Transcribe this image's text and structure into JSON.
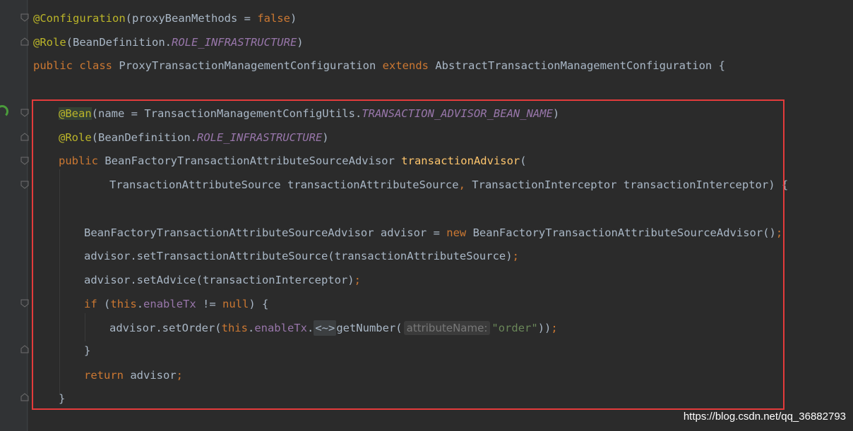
{
  "code": {
    "l1": {
      "ann": "@Configuration",
      "open": "(",
      "param": "proxyBeanMethods = ",
      "val": "false",
      "close": ")"
    },
    "l2": {
      "ann": "@Role",
      "open": "(BeanDefinition.",
      "const": "ROLE_INFRASTRUCTURE",
      "close": ")"
    },
    "l3": {
      "kw1": "public",
      "kw2": "class",
      "name": "ProxyTransactionManagementConfiguration",
      "kw3": "extends",
      "parent": "AbstractTransactionManagementConfiguration {"
    },
    "l5": {
      "ann": "@Bean",
      "open": "(name = TransactionManagementConfigUtils.",
      "const": "TRANSACTION_ADVISOR_BEAN_NAME",
      "close": ")"
    },
    "l6": {
      "ann": "@Role",
      "open": "(BeanDefinition.",
      "const": "ROLE_INFRASTRUCTURE",
      "close": ")"
    },
    "l7": {
      "kw": "public",
      "type": "BeanFactoryTransactionAttributeSourceAdvisor",
      "method": "transactionAdvisor",
      "open": "("
    },
    "l8": {
      "p1": "TransactionAttributeSource transactionAttributeSource",
      "comma": ",",
      "p2": "TransactionInterceptor transactionInterceptor) {"
    },
    "l10": {
      "decl": "BeanFactoryTransactionAttributeSourceAdvisor advisor = ",
      "kw": "new",
      "ctor": "BeanFactoryTransactionAttributeSourceAdvisor()",
      "semi": ";"
    },
    "l11": {
      "text": "advisor.setTransactionAttributeSource(transactionAttributeSource)",
      "semi": ";"
    },
    "l12": {
      "text": "advisor.setAdvice(transactionInterceptor)",
      "semi": ";"
    },
    "l13": {
      "kw": "if",
      "open": "(",
      "this": "this",
      "dot": ".",
      "field": "enableTx",
      "op": " != ",
      "null": "null",
      "close": ") {"
    },
    "l14": {
      "pre": "advisor.setOrder(",
      "this": "this",
      "dot": ".",
      "field": "enableTx",
      "dot2": ".",
      "fold": "<~>",
      "call": "getNumber(",
      "hint": "attributeName:",
      "str": "\"order\"",
      "close": "))",
      "semi": ";"
    },
    "l15": {
      "text": "}"
    },
    "l16": {
      "kw": "return",
      "text": " advisor",
      "semi": ";"
    },
    "l17": {
      "text": "}"
    }
  },
  "watermark": "https://blog.csdn.net/qq_36882793",
  "colors": {
    "highlight_box": "#e43b3b",
    "annotation": "#bbb529",
    "keyword": "#cc7832",
    "constant": "#9876aa",
    "method": "#ffc66d",
    "string": "#6a8759"
  }
}
